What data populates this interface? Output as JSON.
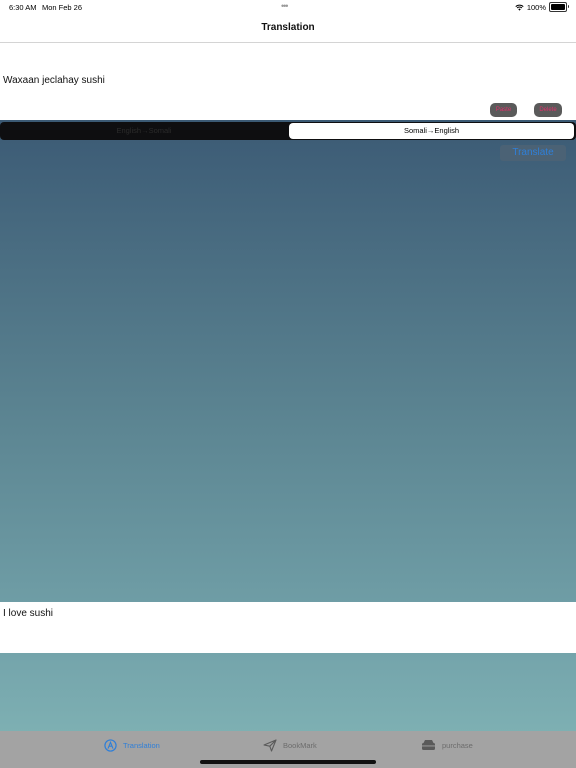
{
  "status_bar": {
    "time": "6:30 AM",
    "date": "Mon Feb 26",
    "dots": "•••",
    "battery": "100%"
  },
  "nav": {
    "title": "Translation"
  },
  "input": {
    "text": "Waxaan jeclahay sushi",
    "button_a": "Paste",
    "button_b": "Delete"
  },
  "segment": {
    "left_label": "English→Somali",
    "right_label": "Somali→English",
    "selected": "Somali→English"
  },
  "translate_button": "Translate",
  "output": {
    "text": "I love sushi"
  },
  "tabs": [
    {
      "label": "Translation",
      "icon": "translation-icon",
      "active": true
    },
    {
      "label": "BookMark",
      "icon": "paper-plane-icon",
      "active": false
    },
    {
      "label": "purchase",
      "icon": "store-icon",
      "active": false
    }
  ],
  "colors": {
    "accent": "#2f7fd8",
    "button_text": "#e0306b",
    "tab_bar": "#a3a3a3"
  }
}
